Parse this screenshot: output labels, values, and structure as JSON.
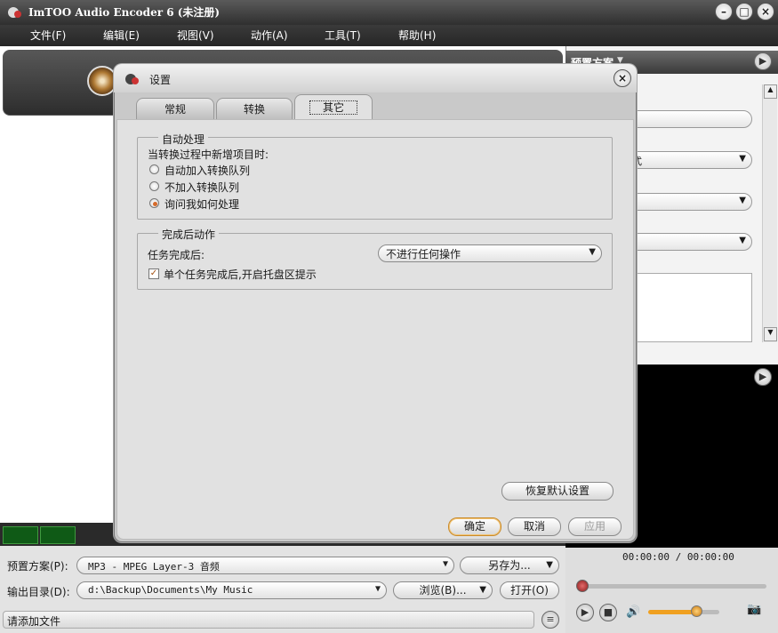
{
  "app": {
    "title": "ImTOO Audio Encoder 6 (未注册)"
  },
  "menu": [
    "文件(F)",
    "编辑(E)",
    "视图(V)",
    "动作(A)",
    "工具(T)",
    "帮助(H)"
  ],
  "right_panel": {
    "header": "预置方案",
    "field_fragment": "式"
  },
  "player": {
    "time": "00:00:00 / 00:00:00"
  },
  "bottom": {
    "preset_label": "预置方案(P):",
    "preset_value": "MP3 - MPEG Layer-3 音频",
    "save_as": "另存为...",
    "output_label": "输出目录(D):",
    "output_value": "d:\\Backup\\Documents\\My Music",
    "browse": "浏览(B)...",
    "open": "打开(O)",
    "status": "请添加文件"
  },
  "dialog": {
    "title": "设置",
    "tabs": [
      "常规",
      "转换",
      "其它"
    ],
    "active_tab": "其它",
    "auto_group": {
      "legend": "自动处理",
      "prompt": "当转换过程中新增项目时:",
      "options": [
        "自动加入转换队列",
        "不加入转换队列",
        "询问我如何处理"
      ],
      "selected": "询问我如何处理"
    },
    "after_group": {
      "legend": "完成后动作",
      "task_label": "任务完成后:",
      "task_value": "不进行任何操作",
      "tray_label": "单个任务完成后,开启托盘区提示",
      "tray_checked": true
    },
    "restore": "恢复默认设置",
    "ok": "确定",
    "cancel": "取消",
    "apply": "应用"
  }
}
